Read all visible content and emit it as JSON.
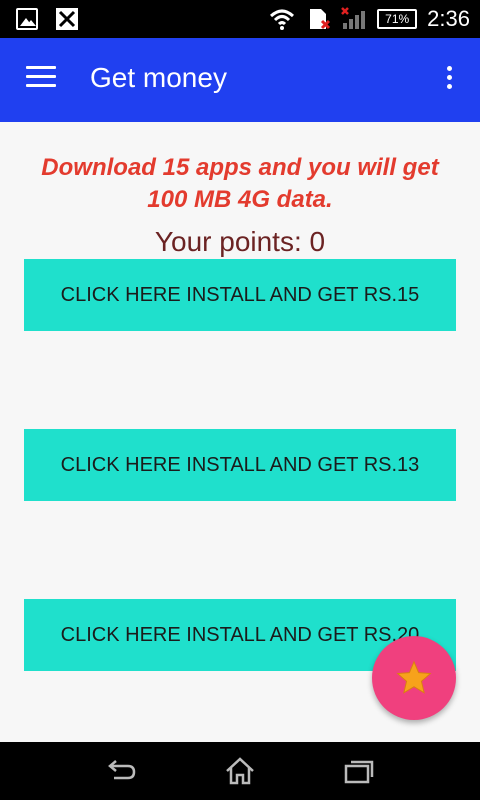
{
  "status_bar": {
    "battery_percent": "71%",
    "time": "2:36"
  },
  "app_bar": {
    "title": "Get money"
  },
  "main": {
    "promo_text": "Download  15 apps and you will get 100 MB 4G data.",
    "points_text": "Your points: 0",
    "offers": [
      {
        "label": "CLICK HERE INSTALL AND GET RS.15"
      },
      {
        "label": "CLICK HERE INSTALL AND GET RS.13"
      },
      {
        "label": "CLICK HERE INSTALL AND GET RS.20"
      }
    ]
  },
  "icons": {
    "menu": "hamburger-menu-icon",
    "overflow": "more-vert-icon",
    "fab": "star-icon",
    "nav": [
      "back-icon",
      "home-icon",
      "recent-apps-icon"
    ]
  },
  "colors": {
    "app_bar": "#2040f0",
    "offer_button": "#1fe0cc",
    "promo_text": "#e33b2e",
    "fab": "#f0407e",
    "star": "#f7a21b"
  }
}
